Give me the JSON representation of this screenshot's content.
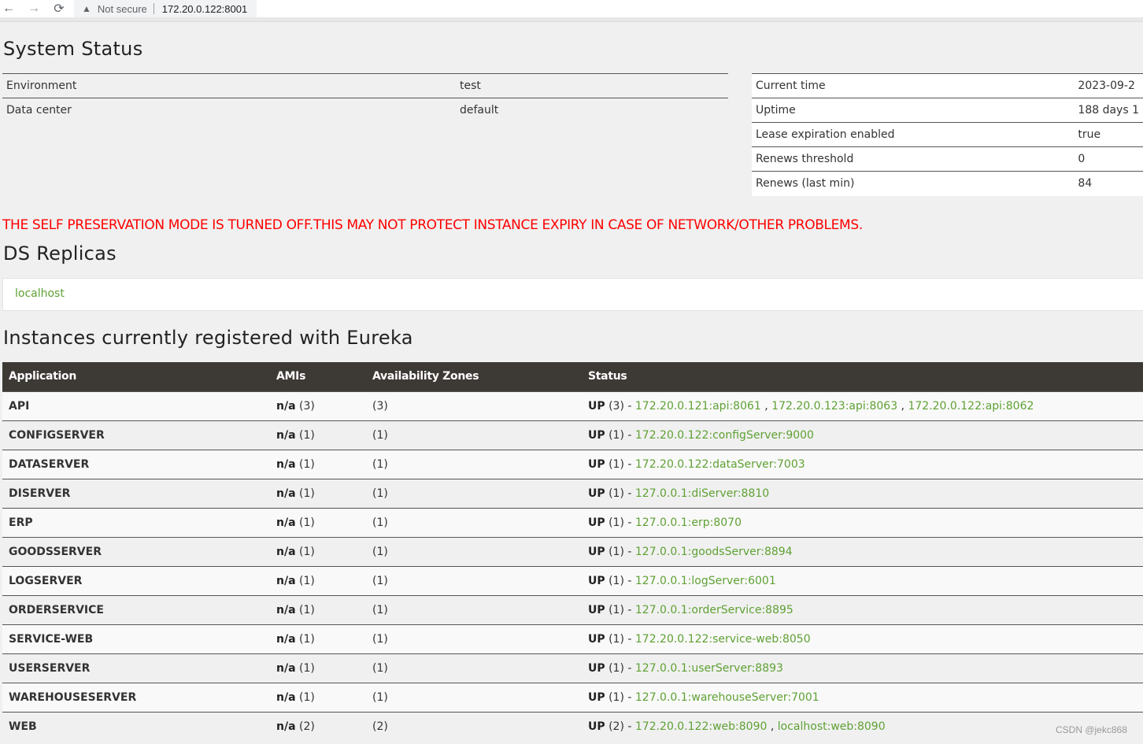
{
  "browser": {
    "back_icon": "←",
    "forward_icon": "→",
    "reload_icon": "⟳",
    "warn_icon": "▲",
    "not_secure": "Not secure",
    "url": "172.20.0.122:8001"
  },
  "system_status": {
    "title": "System Status",
    "left": [
      {
        "key": "Environment",
        "value": "test"
      },
      {
        "key": "Data center",
        "value": "default"
      }
    ],
    "right": [
      {
        "key": "Current time",
        "value": "2023-09-2"
      },
      {
        "key": "Uptime",
        "value": "188 days 1"
      },
      {
        "key": "Lease expiration enabled",
        "value": "true"
      },
      {
        "key": "Renews threshold",
        "value": "0"
      },
      {
        "key": "Renews (last min)",
        "value": "84"
      }
    ]
  },
  "warning": "THE SELF PRESERVATION MODE IS TURNED OFF.THIS MAY NOT PROTECT INSTANCE EXPIRY IN CASE OF NETWORK/OTHER PROBLEMS.",
  "replicas": {
    "title": "DS Replicas",
    "link": "localhost"
  },
  "instances": {
    "title": "Instances currently registered with Eureka",
    "headers": {
      "app": "Application",
      "ami": "AMIs",
      "zone": "Availability Zones",
      "status": "Status"
    },
    "rows": [
      {
        "app": "API",
        "ami_label": "n/a",
        "ami_count": " (3)",
        "zone": "(3)",
        "status_label": "UP",
        "status_count": " (3) - ",
        "links": [
          "172.20.0.121:api:8061",
          "172.20.0.123:api:8063",
          "172.20.0.122:api:8062"
        ]
      },
      {
        "app": "CONFIGSERVER",
        "ami_label": "n/a",
        "ami_count": " (1)",
        "zone": "(1)",
        "status_label": "UP",
        "status_count": " (1) - ",
        "links": [
          "172.20.0.122:configServer:9000"
        ]
      },
      {
        "app": "DATASERVER",
        "ami_label": "n/a",
        "ami_count": " (1)",
        "zone": "(1)",
        "status_label": "UP",
        "status_count": " (1) - ",
        "links": [
          "172.20.0.122:dataServer:7003"
        ]
      },
      {
        "app": "DISERVER",
        "ami_label": "n/a",
        "ami_count": " (1)",
        "zone": "(1)",
        "status_label": "UP",
        "status_count": " (1) - ",
        "links": [
          "127.0.0.1:diServer:8810"
        ]
      },
      {
        "app": "ERP",
        "ami_label": "n/a",
        "ami_count": " (1)",
        "zone": "(1)",
        "status_label": "UP",
        "status_count": " (1) - ",
        "links": [
          "127.0.0.1:erp:8070"
        ]
      },
      {
        "app": "GOODSSERVER",
        "ami_label": "n/a",
        "ami_count": " (1)",
        "zone": "(1)",
        "status_label": "UP",
        "status_count": " (1) - ",
        "links": [
          "127.0.0.1:goodsServer:8894"
        ]
      },
      {
        "app": "LOGSERVER",
        "ami_label": "n/a",
        "ami_count": " (1)",
        "zone": "(1)",
        "status_label": "UP",
        "status_count": " (1) - ",
        "links": [
          "127.0.0.1:logServer:6001"
        ]
      },
      {
        "app": "ORDERSERVICE",
        "ami_label": "n/a",
        "ami_count": " (1)",
        "zone": "(1)",
        "status_label": "UP",
        "status_count": " (1) - ",
        "links": [
          "127.0.0.1:orderService:8895"
        ]
      },
      {
        "app": "SERVICE-WEB",
        "ami_label": "n/a",
        "ami_count": " (1)",
        "zone": "(1)",
        "status_label": "UP",
        "status_count": " (1) - ",
        "links": [
          "172.20.0.122:service-web:8050"
        ]
      },
      {
        "app": "USERSERVER",
        "ami_label": "n/a",
        "ami_count": " (1)",
        "zone": "(1)",
        "status_label": "UP",
        "status_count": " (1) - ",
        "links": [
          "127.0.0.1:userServer:8893"
        ]
      },
      {
        "app": "WAREHOUSESERVER",
        "ami_label": "n/a",
        "ami_count": " (1)",
        "zone": "(1)",
        "status_label": "UP",
        "status_count": " (1) - ",
        "links": [
          "127.0.0.1:warehouseServer:7001"
        ]
      },
      {
        "app": "WEB",
        "ami_label": "n/a",
        "ami_count": " (2)",
        "zone": "(2)",
        "status_label": "UP",
        "status_count": " (2) - ",
        "links": [
          "172.20.0.122:web:8090",
          "localhost:web:8090"
        ]
      }
    ]
  },
  "watermark": "CSDN @jekc868",
  "colors": {
    "link": "#5fa134",
    "warning": "#ff0000",
    "table_header": "#3d3934"
  }
}
